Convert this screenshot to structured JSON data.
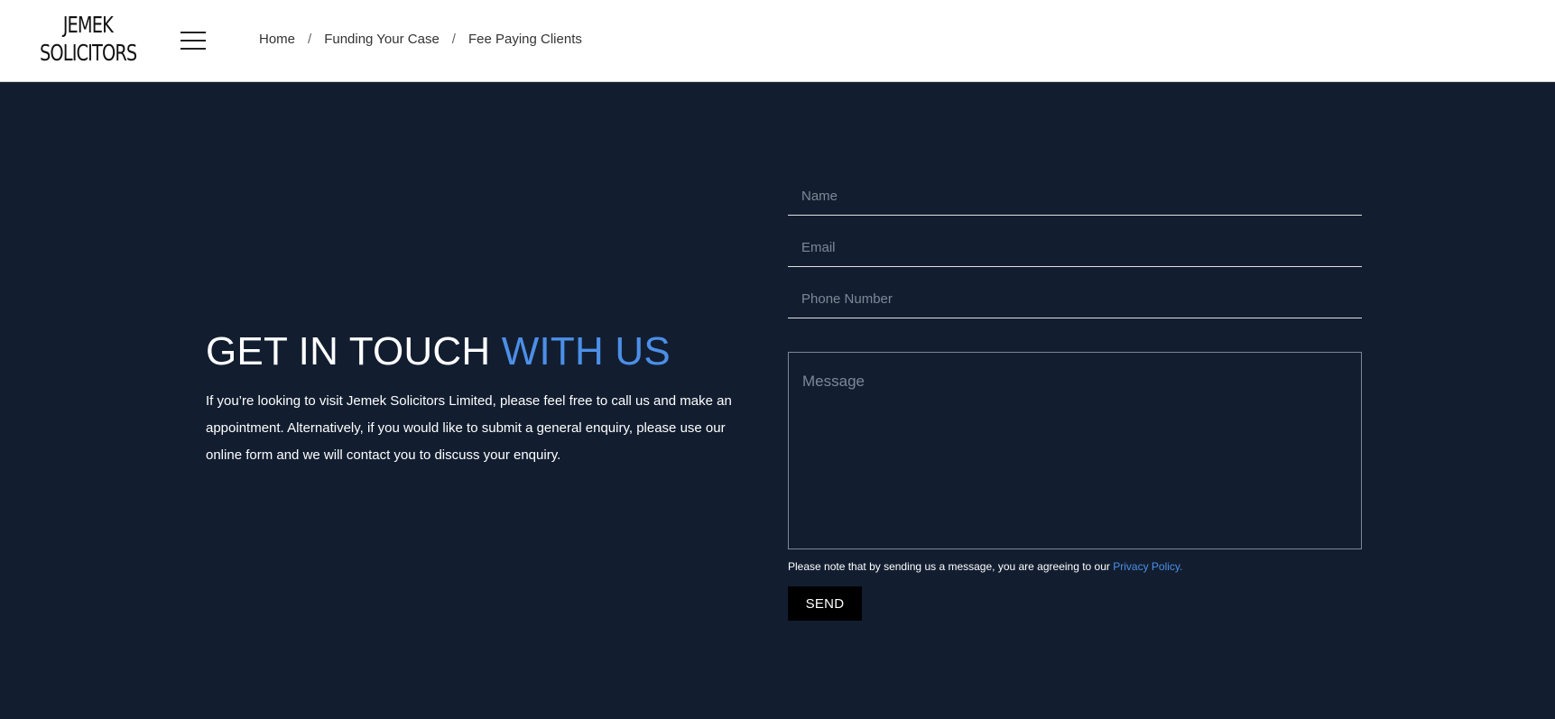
{
  "header": {
    "logo_line1": "JEMEK",
    "logo_line2": "SOLICITORS",
    "menu_icon": "hamburger-menu-icon",
    "breadcrumb": [
      {
        "label": "Home"
      },
      {
        "label": "Funding Your Case"
      },
      {
        "label": "Fee Paying Clients"
      }
    ],
    "breadcrumb_separator": "/"
  },
  "contact": {
    "heading_main": "GET IN TOUCH ",
    "heading_accent": "WITH US",
    "description": "If you’re looking to visit Jemek Solicitors Limited, please feel free to call us and make an appointment. Alternatively, if you would like to submit a general enquiry, please use our online form and we will contact you to discuss your enquiry."
  },
  "form": {
    "name_placeholder": "Name",
    "name_value": "",
    "email_placeholder": "Email",
    "email_value": "",
    "phone_placeholder": "Phone Number",
    "phone_value": "",
    "message_placeholder": "Message",
    "message_value": "",
    "note_text": "Please note that by sending us a message, you are agreeing to our ",
    "privacy_link": "Privacy Policy.",
    "send_label": "SEND"
  },
  "colors": {
    "background": "#121e30",
    "accent": "#4c8fe8",
    "header_bg": "#ffffff",
    "button_bg": "#000000"
  }
}
